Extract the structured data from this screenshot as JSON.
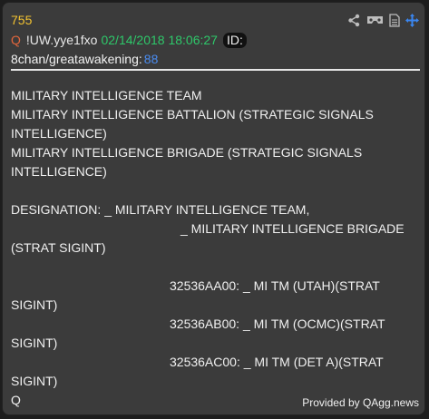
{
  "post": {
    "number": "755",
    "q_label": "Q",
    "tripcode": "!UW.yye1fxo",
    "datetime": "02/14/2018 18:06:27",
    "id_label": "ID:",
    "board": "8chan/greatawakening:",
    "board_number": "88"
  },
  "icons": [
    "share-icon",
    "vr-goggles-icon",
    "document-icon",
    "move-icon"
  ],
  "colors": {
    "number": "#f2c230",
    "q_label": "#e2663c",
    "date": "#2ec86a",
    "board_number": "#4a8cf0",
    "card_bg": "#3b3b3b"
  },
  "body_lines": [
    "MILITARY INTELLIGENCE TEAM",
    "MILITARY INTELLIGENCE BATTALION (STRATEGIC SIGNALS",
    "INTELLIGENCE)",
    "MILITARY INTELLIGENCE BRIGADE (STRATEGIC SIGNALS",
    "INTELLIGENCE)",
    "",
    "DESIGNATION: _ MILITARY INTELLIGENCE TEAM,",
    "_ MILITARY INTELLIGENCE BRIGADE",
    "(STRAT SIGINT)",
    "",
    "32536AA00: _ MI TM (UTAH)(STRAT",
    "SIGINT)",
    "32536AB00: _ MI TM (OCMC)(STRAT",
    "SIGINT)",
    "32536AC00: _ MI TM (DET A)(STRAT",
    "SIGINT)",
    "Q"
  ],
  "footer": "Provided by QAgg.news"
}
